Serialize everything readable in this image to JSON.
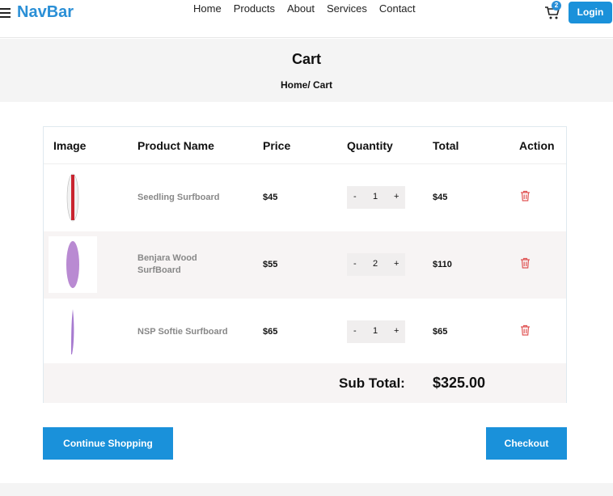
{
  "nav": {
    "brand": "NavBar",
    "links": [
      "Home",
      "Products",
      "About",
      "Services",
      "Contact"
    ],
    "cart_count": "2",
    "login_label": "Login"
  },
  "hero": {
    "title": "Cart",
    "breadcrumb": "Home/ Cart"
  },
  "table": {
    "headers": [
      "Image",
      "Product Name",
      "Price",
      "Quantity",
      "Total",
      "Action"
    ],
    "rows": [
      {
        "name": "Seedling Surfboard",
        "price": "$45",
        "qty": "1",
        "total": "$45",
        "minus": "-",
        "plus": "+"
      },
      {
        "name": "Benjara Wood SurfBoard",
        "price": "$55",
        "qty": "2",
        "total": "$110",
        "minus": "-",
        "plus": "+"
      },
      {
        "name": "NSP Softie Surfboard",
        "price": "$65",
        "qty": "1",
        "total": "$65",
        "minus": "-",
        "plus": "+"
      }
    ],
    "subtotal_label": "Sub Total:",
    "subtotal_value": "$325.00"
  },
  "actions": {
    "continue_label": "Continue Shopping",
    "checkout_label": "Checkout"
  },
  "colors": {
    "accent": "#1a91da",
    "delete": "#e05555"
  }
}
